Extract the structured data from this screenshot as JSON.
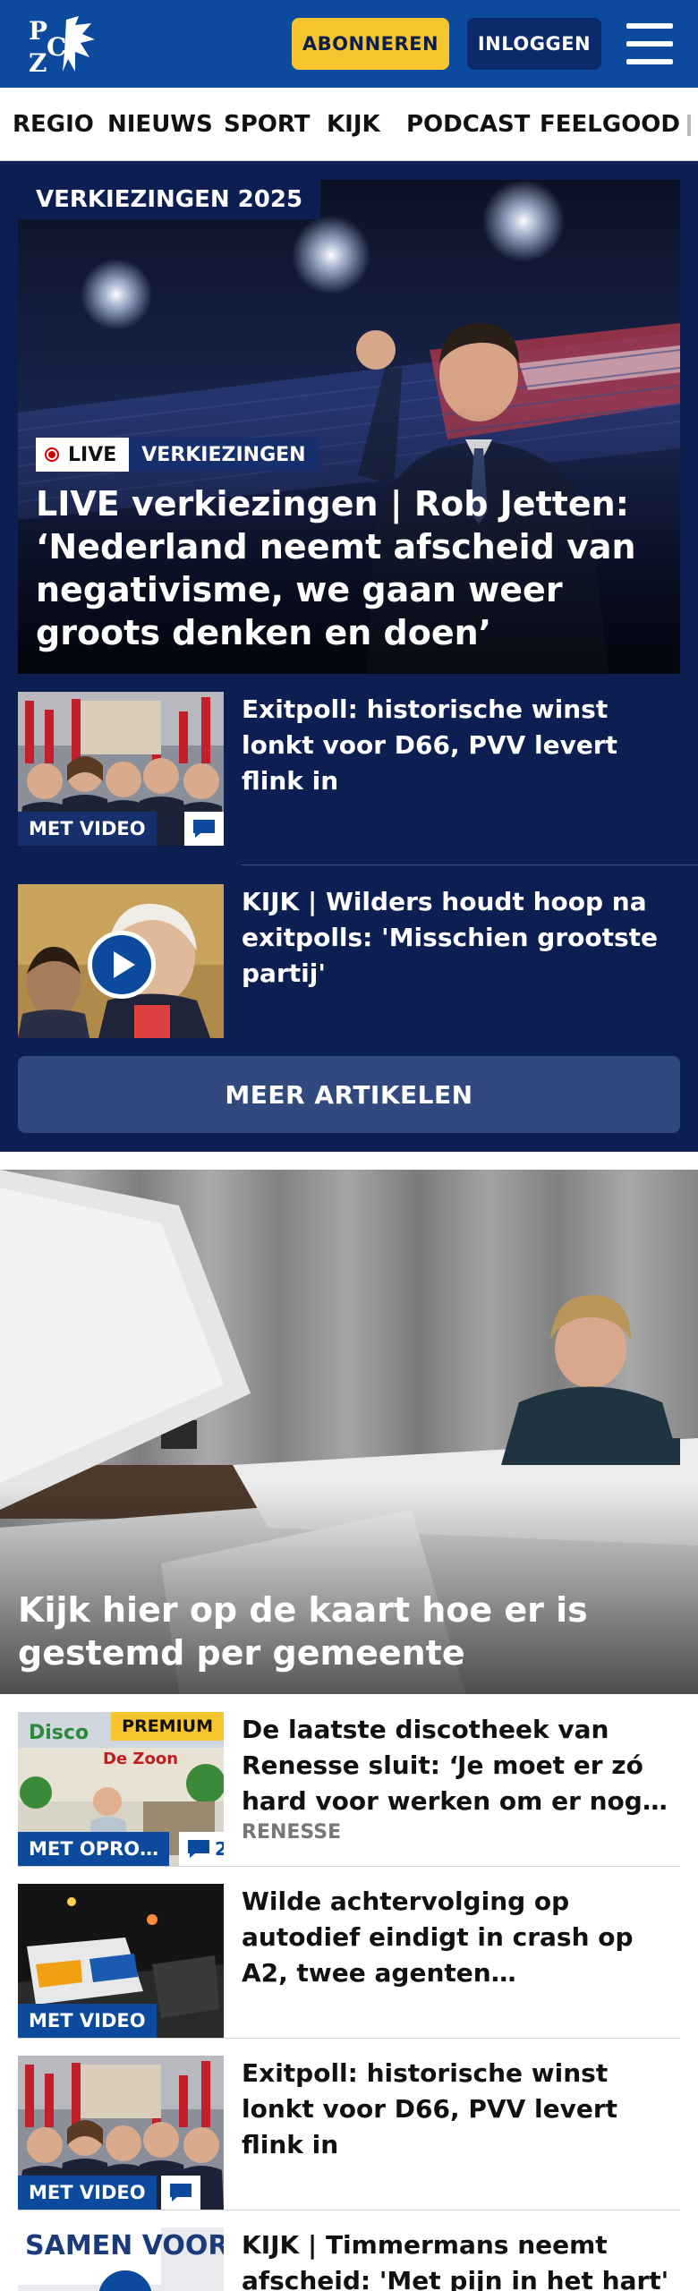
{
  "header": {
    "logo_text": "PZC",
    "subscribe_label": "ABONNEREN",
    "login_label": "INLOGGEN"
  },
  "nav": {
    "items": [
      "REGIO",
      "NIEUWS",
      "SPORT",
      "KIJK",
      "PODCAST",
      "FEELGOOD"
    ]
  },
  "election": {
    "section_label": "VERKIEZINGEN 2025",
    "hero": {
      "live_label": "LIVE",
      "category": "VERKIEZINGEN",
      "title": "LIVE verkiezingen | Rob Jetten: ‘Nederland neemt afscheid van negativisme, we gaan weer groots denken en doen’"
    },
    "articles": [
      {
        "title": "Exitpoll: historische winst lonkt voor D66, PVV levert flink in",
        "badge": "MET VIDEO",
        "comments": ""
      },
      {
        "title": "KIJK | Wilders houdt hoop na exitpolls: 'Misschien grootste partij'"
      }
    ],
    "more_label": "MEER ARTIKELEN"
  },
  "feature": {
    "title": "Kijk hier op de kaart hoe er is gestemd per gemeente"
  },
  "list": [
    {
      "title": "De laatste discotheek van Renesse sluit: ‘Je moet er zó hard voor werken om er nog wat uit te halen’",
      "badge": "MET OPRO…",
      "comments": "2",
      "premium": "PREMIUM",
      "location": "RENESSE"
    },
    {
      "title": "Wilde achtervolging op autodief eindigt in crash op A2, twee agenten zwaargewond: ‘Ze zijn in shock’",
      "badge": "MET VIDEO"
    },
    {
      "title": "Exitpoll: historische winst lonkt voor D66, PVV levert flink in",
      "badge": "MET VIDEO",
      "comments": ""
    },
    {
      "title": "KIJK | Timmermans neemt afscheid: 'Met pijn in het hart'",
      "thumb_text": "SAMEN VOORUIT"
    }
  ],
  "colors": {
    "brand_blue": "#0b4a9c",
    "navy": "#0d1f52",
    "accent_yellow": "#f7c52f",
    "live_red": "#d40000"
  }
}
